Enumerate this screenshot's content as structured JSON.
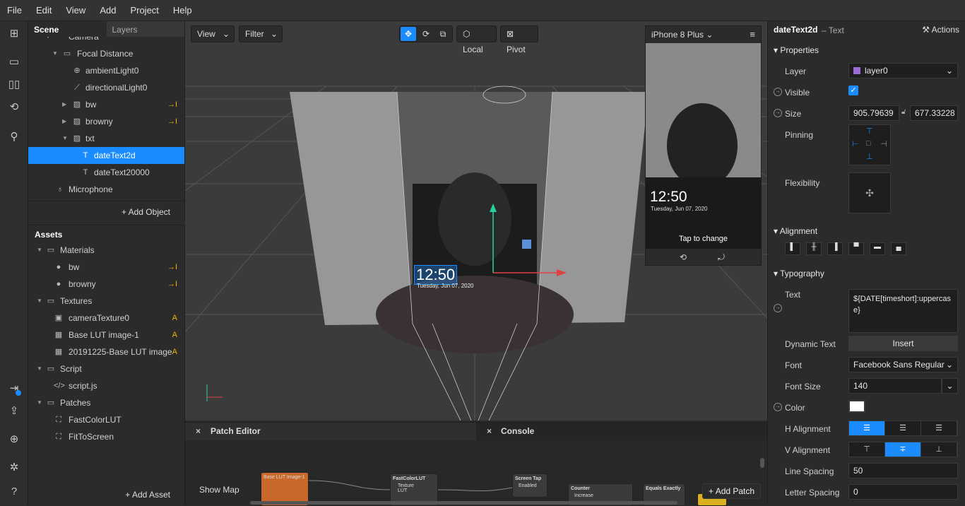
{
  "menu": [
    "File",
    "Edit",
    "View",
    "Add",
    "Project",
    "Help"
  ],
  "scene_tabs": {
    "scene": "Scene",
    "layers": "Layers"
  },
  "scene_tree": [
    {
      "label": "Camera",
      "indent": 1
    },
    {
      "label": "Focal Distance",
      "indent": 2
    },
    {
      "label": "ambientLight0",
      "indent": 3
    },
    {
      "label": "directionalLight0",
      "indent": 3
    },
    {
      "label": "bw",
      "indent": 3
    },
    {
      "label": "browny",
      "indent": 3
    },
    {
      "label": "txt",
      "indent": 3
    },
    {
      "label": "dateText2d",
      "indent": 4
    },
    {
      "label": "dateText20000",
      "indent": 4
    },
    {
      "label": "Microphone",
      "indent": 2
    }
  ],
  "add_object": "Add Object",
  "assets": {
    "title": "Assets",
    "items": [
      "Materials",
      "bw",
      "browny",
      "Textures",
      "cameraTexture0",
      "Base LUT image-1",
      "20191225-Base LUT image",
      "Script",
      "script.js",
      "Patches",
      "FastColorLUT",
      "FitToScreen"
    ],
    "badges": {
      "texture": "A"
    },
    "add_asset": "Add Asset"
  },
  "viewport": {
    "view": "View",
    "filter": "Filter",
    "local": "Local",
    "pivot": "Pivot",
    "clock": "12:50",
    "date": "Tuesday, Jun 07, 2020"
  },
  "simulator": {
    "device": "iPhone 8 Plus",
    "clock": "12:50",
    "date": "Tuesday, Jun 07, 2020",
    "tap": "Tap to change"
  },
  "bottom": {
    "patch_editor": "Patch Editor",
    "console": "Console",
    "show_map": "Show Map",
    "add_patch": "Add Patch",
    "nodes": {
      "lut": "Base LUT Image-1",
      "fcl": "FastColorLUT",
      "texture": "Texture",
      "lut_port": "LUT",
      "tap": "Screen Tap",
      "enabled": "Enabled",
      "counter": "Counter",
      "increase": "Increase",
      "equals": "Equals Exactly"
    }
  },
  "props": {
    "object": "dateText2d",
    "type": "– Text",
    "actions": "Actions",
    "properties": "Properties",
    "layer_label": "Layer",
    "layer_value": "layer0",
    "visible": "Visible",
    "size": "Size",
    "size_w": "905.79639",
    "size_h": "677.33228",
    "pinning": "Pinning",
    "flexibility": "Flexibility",
    "alignment": "Alignment",
    "typography": "Typography",
    "text": "Text",
    "text_value": "${DATE[timeshort]:uppercase}",
    "dynamic_text": "Dynamic Text",
    "insert": "Insert",
    "font": "Font",
    "font_value": "Facebook Sans Regular",
    "font_size": "Font Size",
    "font_size_value": "140",
    "color": "Color",
    "h_align": "H Alignment",
    "v_align": "V Alignment",
    "line_spacing": "Line Spacing",
    "line_spacing_value": "50",
    "letter_spacing": "Letter Spacing",
    "letter_spacing_value": "0"
  },
  "colors": {
    "accent": "#1a8cff",
    "highlight": "#f0b400",
    "node_orange": "#c8682a"
  }
}
